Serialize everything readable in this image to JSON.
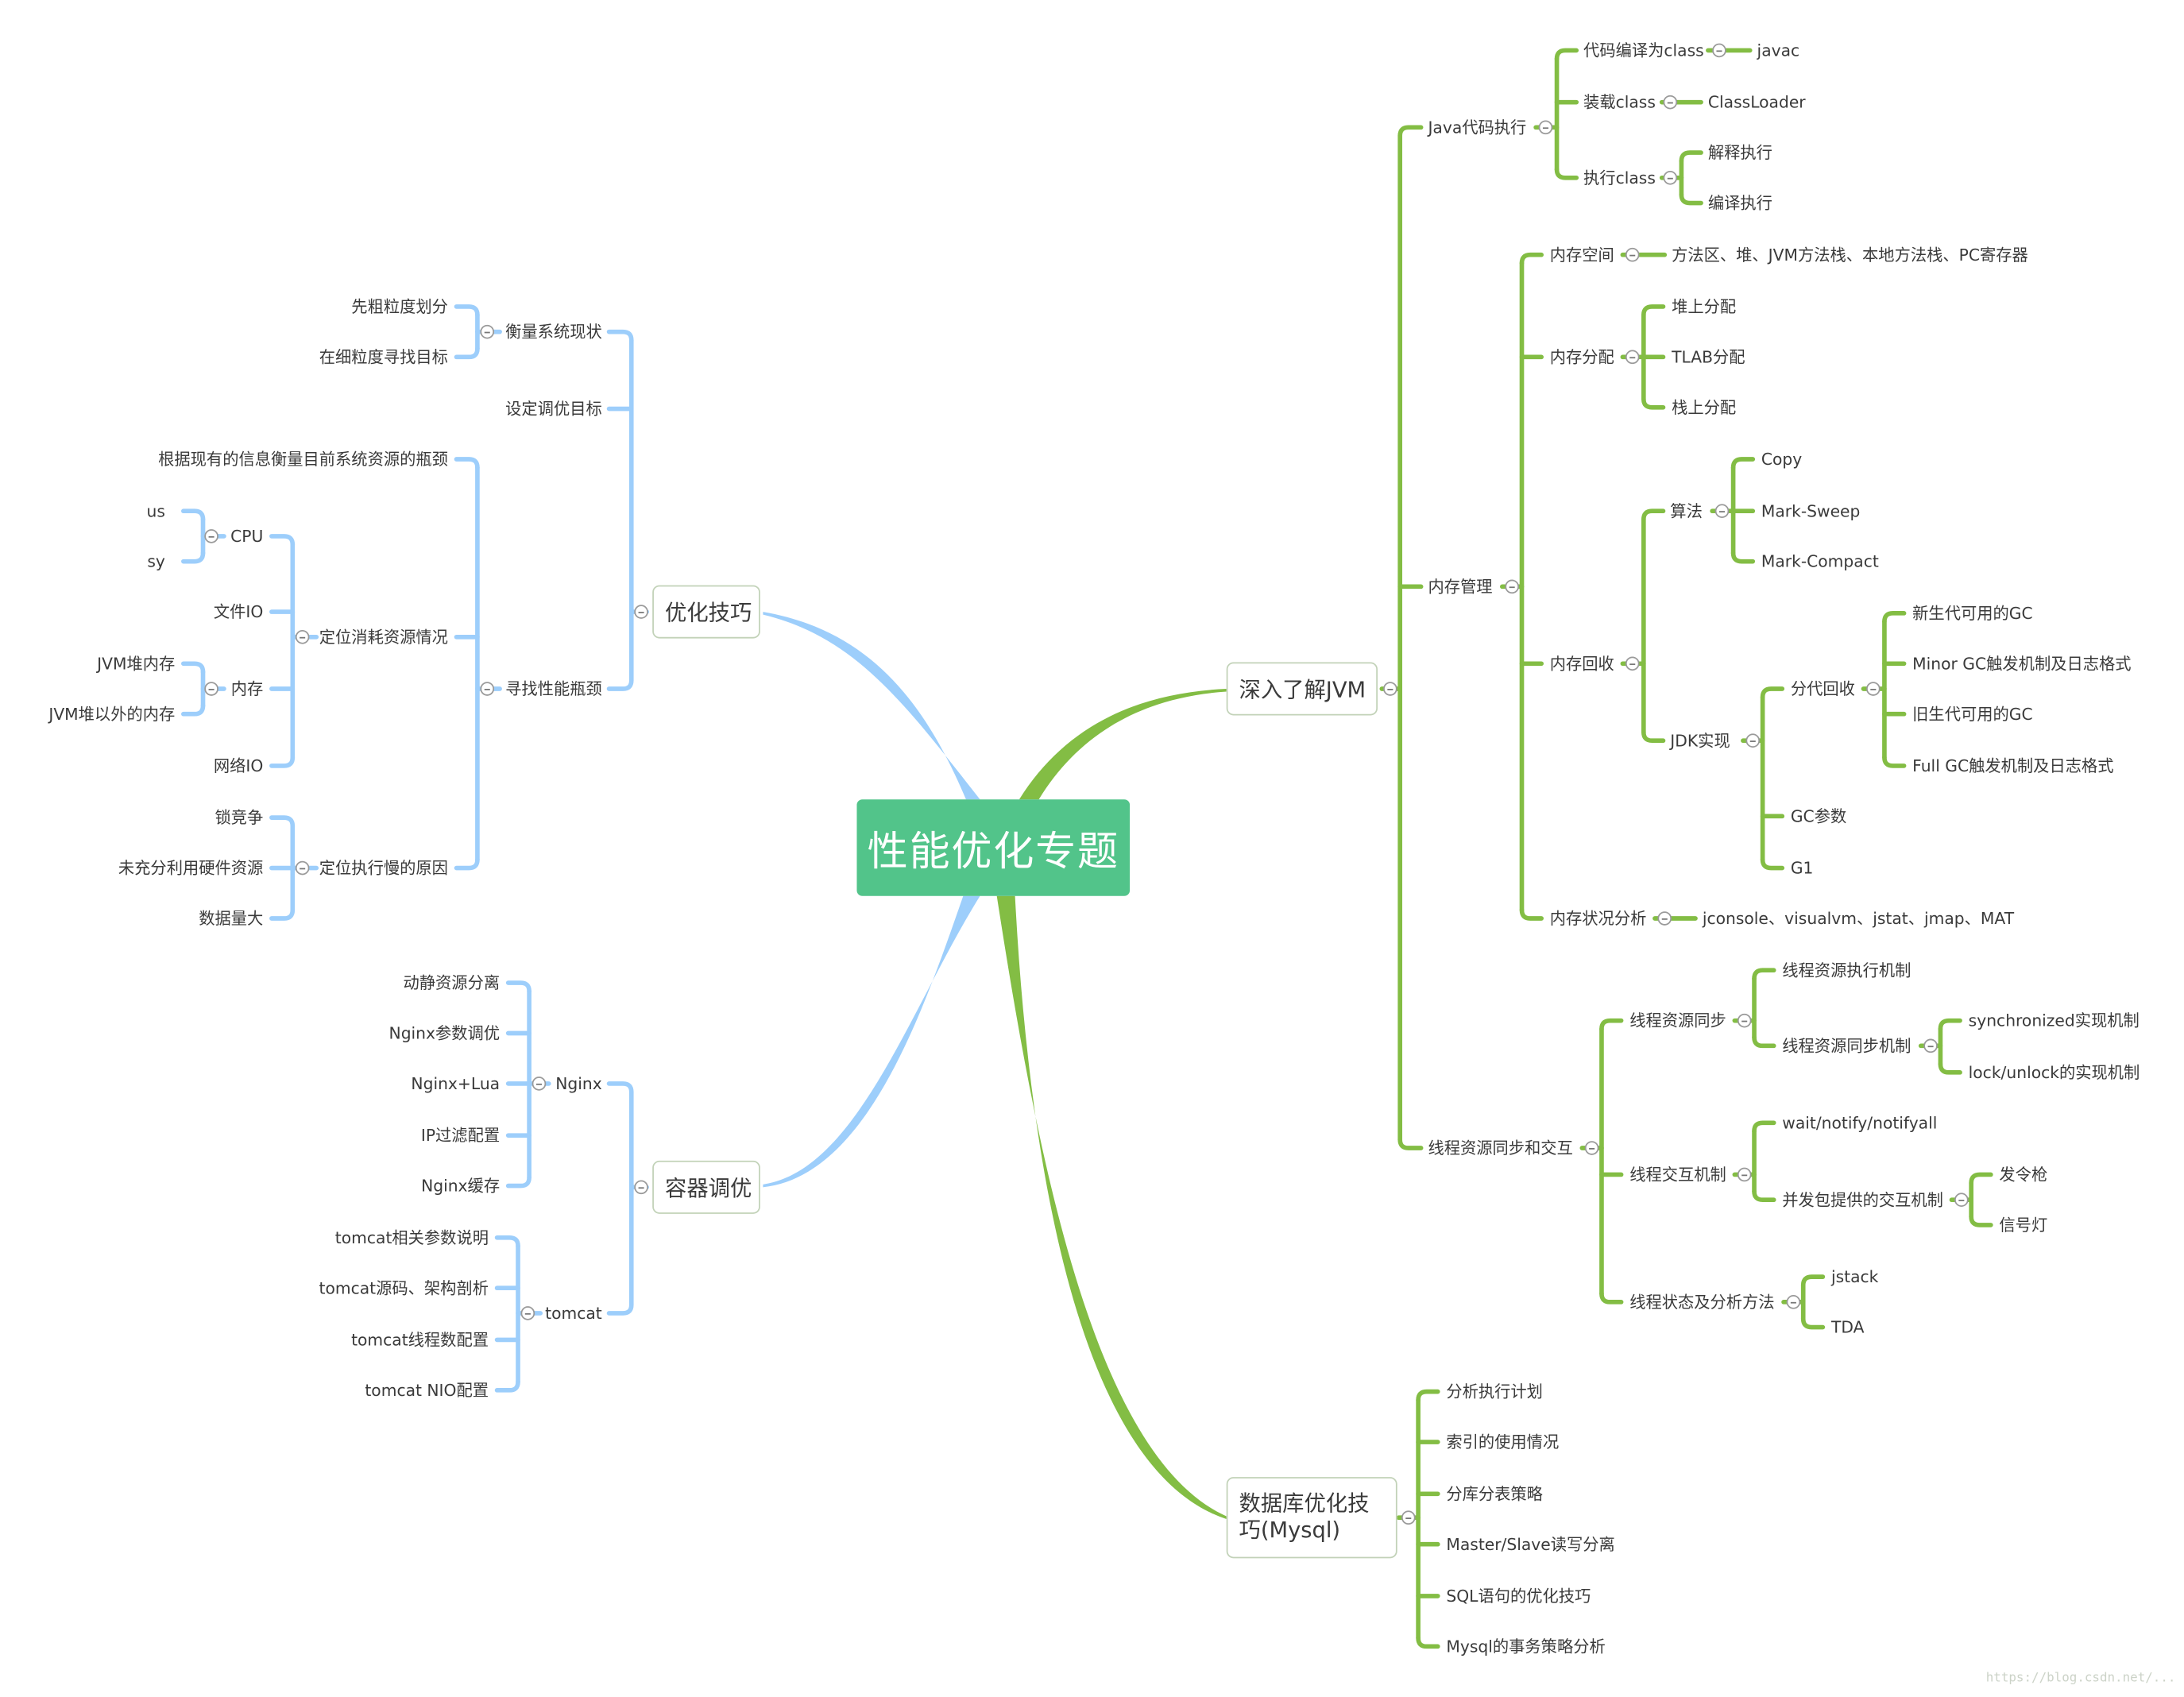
{
  "root": {
    "label": "性能优化专题",
    "color": "#52c48a"
  },
  "colors": {
    "left_branch": "#9dcefb",
    "right_branch": "#83bd44",
    "node_border": "#c2d2b8",
    "text": "#3a3a3a"
  },
  "branches": {
    "optimize": {
      "label": "优化技巧",
      "children": {
        "measure": {
          "label": "衡量系统现状",
          "children": [
            "先粗粒度划分",
            "在细粒度寻找目标"
          ]
        },
        "target": {
          "label": "设定调优目标"
        },
        "find": {
          "label": "寻找性能瓶颈",
          "children": {
            "info": {
              "label": "根据现有的信息衡量目前系统资源的瓶颈"
            },
            "locate_res": {
              "label": "定位消耗资源情况",
              "children": {
                "cpu": {
                  "label": "CPU",
                  "children": [
                    "us",
                    "sy"
                  ]
                },
                "fileio": {
                  "label": "文件IO"
                },
                "mem": {
                  "label": "内存",
                  "children": [
                    "JVM堆内存",
                    "JVM堆以外的内存"
                  ]
                },
                "netio": {
                  "label": "网络IO"
                }
              }
            },
            "locate_slow": {
              "label": "定位执行慢的原因",
              "children": [
                "锁竞争",
                "未充分利用硬件资源",
                "数据量大"
              ]
            }
          }
        }
      }
    },
    "container": {
      "label": "容器调优",
      "children": {
        "nginx": {
          "label": "Nginx",
          "children": [
            "动静资源分离",
            "Nginx参数调优",
            "Nginx+Lua",
            "IP过滤配置",
            "Nginx缓存"
          ]
        },
        "tomcat": {
          "label": "tomcat",
          "children": [
            "tomcat相关参数说明",
            "tomcat源码、架构剖析",
            "tomcat线程数配置",
            "tomcat NIO配置"
          ]
        }
      }
    },
    "jvm": {
      "label": "深入了解JVM",
      "children": {
        "exec": {
          "label": "Java代码执行",
          "children": {
            "compile": {
              "label": "代码编译为class",
              "children": [
                "javac"
              ]
            },
            "load": {
              "label": "装载class",
              "children": [
                "ClassLoader"
              ]
            },
            "run": {
              "label": "执行class",
              "children": [
                "解释执行",
                "编译执行"
              ]
            }
          }
        },
        "memory": {
          "label": "内存管理",
          "children": {
            "space": {
              "label": "内存空间",
              "children": [
                "方法区、堆、JVM方法栈、本地方法栈、PC寄存器"
              ]
            },
            "alloc": {
              "label": "内存分配",
              "children": [
                "堆上分配",
                "TLAB分配",
                "栈上分配"
              ]
            },
            "gc": {
              "label": "内存回收",
              "children": {
                "algo": {
                  "label": "算法",
                  "children": [
                    "Copy",
                    "Mark-Sweep",
                    "Mark-Compact"
                  ]
                },
                "jdk": {
                  "label": "JDK实现",
                  "children": {
                    "gen": {
                      "label": "分代回收",
                      "children": [
                        "新生代可用的GC",
                        "Minor GC触发机制及日志格式",
                        "旧生代可用的GC",
                        "Full GC触发机制及日志格式"
                      ]
                    },
                    "params": {
                      "label": "GC参数"
                    },
                    "g1": {
                      "label": "G1"
                    }
                  }
                }
              }
            },
            "analysis": {
              "label": "内存状况分析",
              "children": [
                "jconsole、visualvm、jstat、jmap、MAT"
              ]
            }
          }
        },
        "thread": {
          "label": "线程资源同步和交互",
          "children": {
            "sync": {
              "label": "线程资源同步",
              "children": {
                "exec": {
                  "label": "线程资源执行机制"
                },
                "mech": {
                  "label": "线程资源同步机制",
                  "children": [
                    "synchronized实现机制",
                    "lock/unlock的实现机制"
                  ]
                }
              }
            },
            "interact": {
              "label": "线程交互机制",
              "children": {
                "wait": {
                  "label": "wait/notify/notifyall"
                },
                "conc": {
                  "label": "并发包提供的交互机制",
                  "children": [
                    "发令枪",
                    "信号灯"
                  ]
                }
              }
            },
            "state": {
              "label": "线程状态及分析方法",
              "children": [
                "jstack",
                "TDA"
              ]
            }
          }
        }
      }
    },
    "db": {
      "label": "数据库优化技巧(Mysql)",
      "children": [
        "分析执行计划",
        "索引的使用情况",
        "分库分表策略",
        "Master/Slave读写分离",
        "SQL语句的优化技巧",
        "Mysql的事务策略分析"
      ]
    }
  },
  "watermark": "https://blog.csdn.net/..."
}
